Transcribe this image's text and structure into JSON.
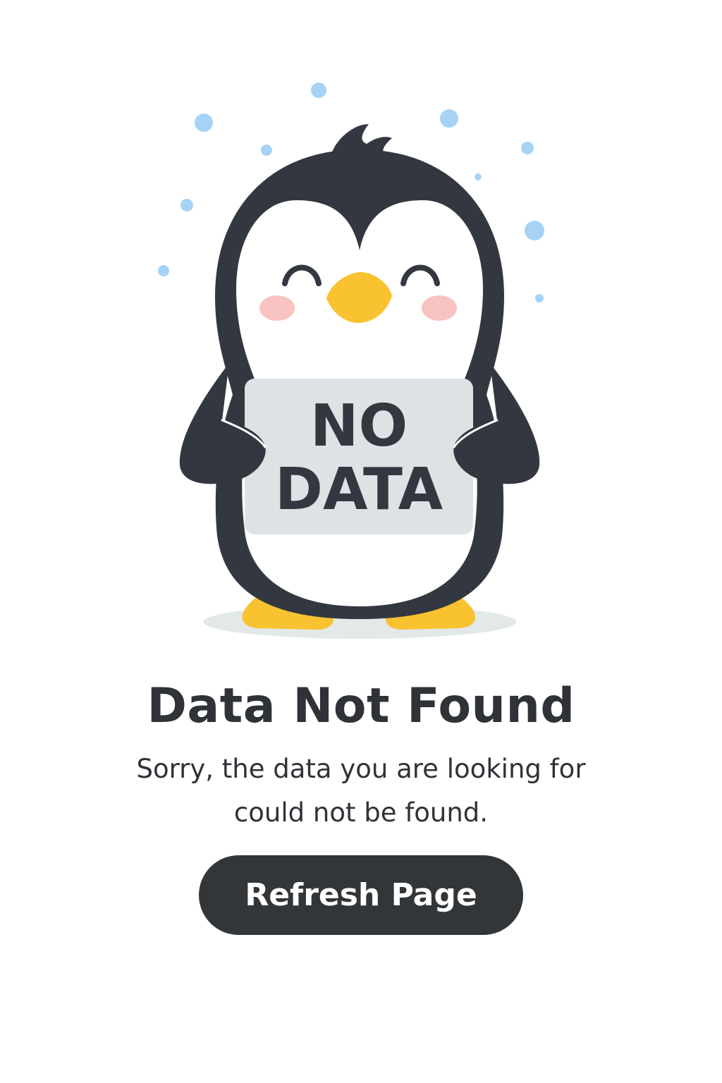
{
  "sign": {
    "line1": "NO",
    "line2": "DATA"
  },
  "title": "Data Not Found",
  "message": "Sorry, the data you are looking for could not be found.",
  "refresh_button": {
    "label": "Refresh Page"
  },
  "colors": {
    "text": "#2f3237",
    "penguin_body": "#333840",
    "penguin_belly": "#ffffff",
    "beak_and_feet": "#f9c231",
    "cheeks": "#f8c3c0",
    "sign_board": "#dde3e4",
    "snow": "#a6d3f5",
    "ground_shadow": "#e3e8e8",
    "button_bg": "#333639",
    "button_text": "#ffffff"
  },
  "icons": {
    "mascot": "penguin-holding-sign-illustration",
    "particles": "snowflake-dots"
  }
}
